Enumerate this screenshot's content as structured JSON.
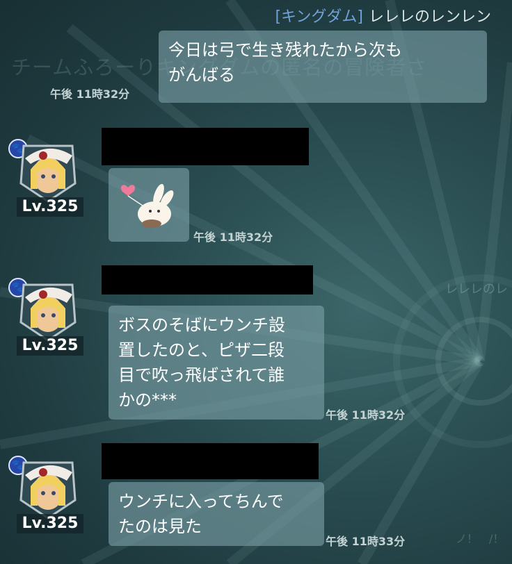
{
  "background": {
    "title_text": "チームふろーりキングダムの匿名の冒険者さ",
    "right_name_fragment": "レレレのレ",
    "corner_fragment": "ノ！　/！"
  },
  "header": {
    "guild_tag": "[キングダム]",
    "sender_name": "レレレのレンレン"
  },
  "messages": [
    {
      "text_lines": [
        "今日は弓で生き残れたから次も",
        "がんばる"
      ],
      "timestamp": "午後 11時32分"
    },
    {
      "level": "Lv.325",
      "sticker": "bunny-with-heart-balloon-sticker",
      "timestamp": "午後 11時32分"
    },
    {
      "level": "Lv.325",
      "text_lines": [
        "ボスのそばにウンチ設",
        "置したのと、ピザ二段",
        "目で吹っ飛ばされて誰",
        "かの***"
      ],
      "timestamp": "午後 11時32分"
    },
    {
      "level": "Lv.325",
      "text_lines": [
        "ウンチに入ってちんで",
        "たのは見た"
      ],
      "timestamp": "午後 11時33分"
    }
  ],
  "colors": {
    "guild_tag": "#6fa2d6",
    "bubble": "#7aa0a6",
    "badge": "#2747a8"
  },
  "icons": {
    "badge": "paw-icon"
  }
}
